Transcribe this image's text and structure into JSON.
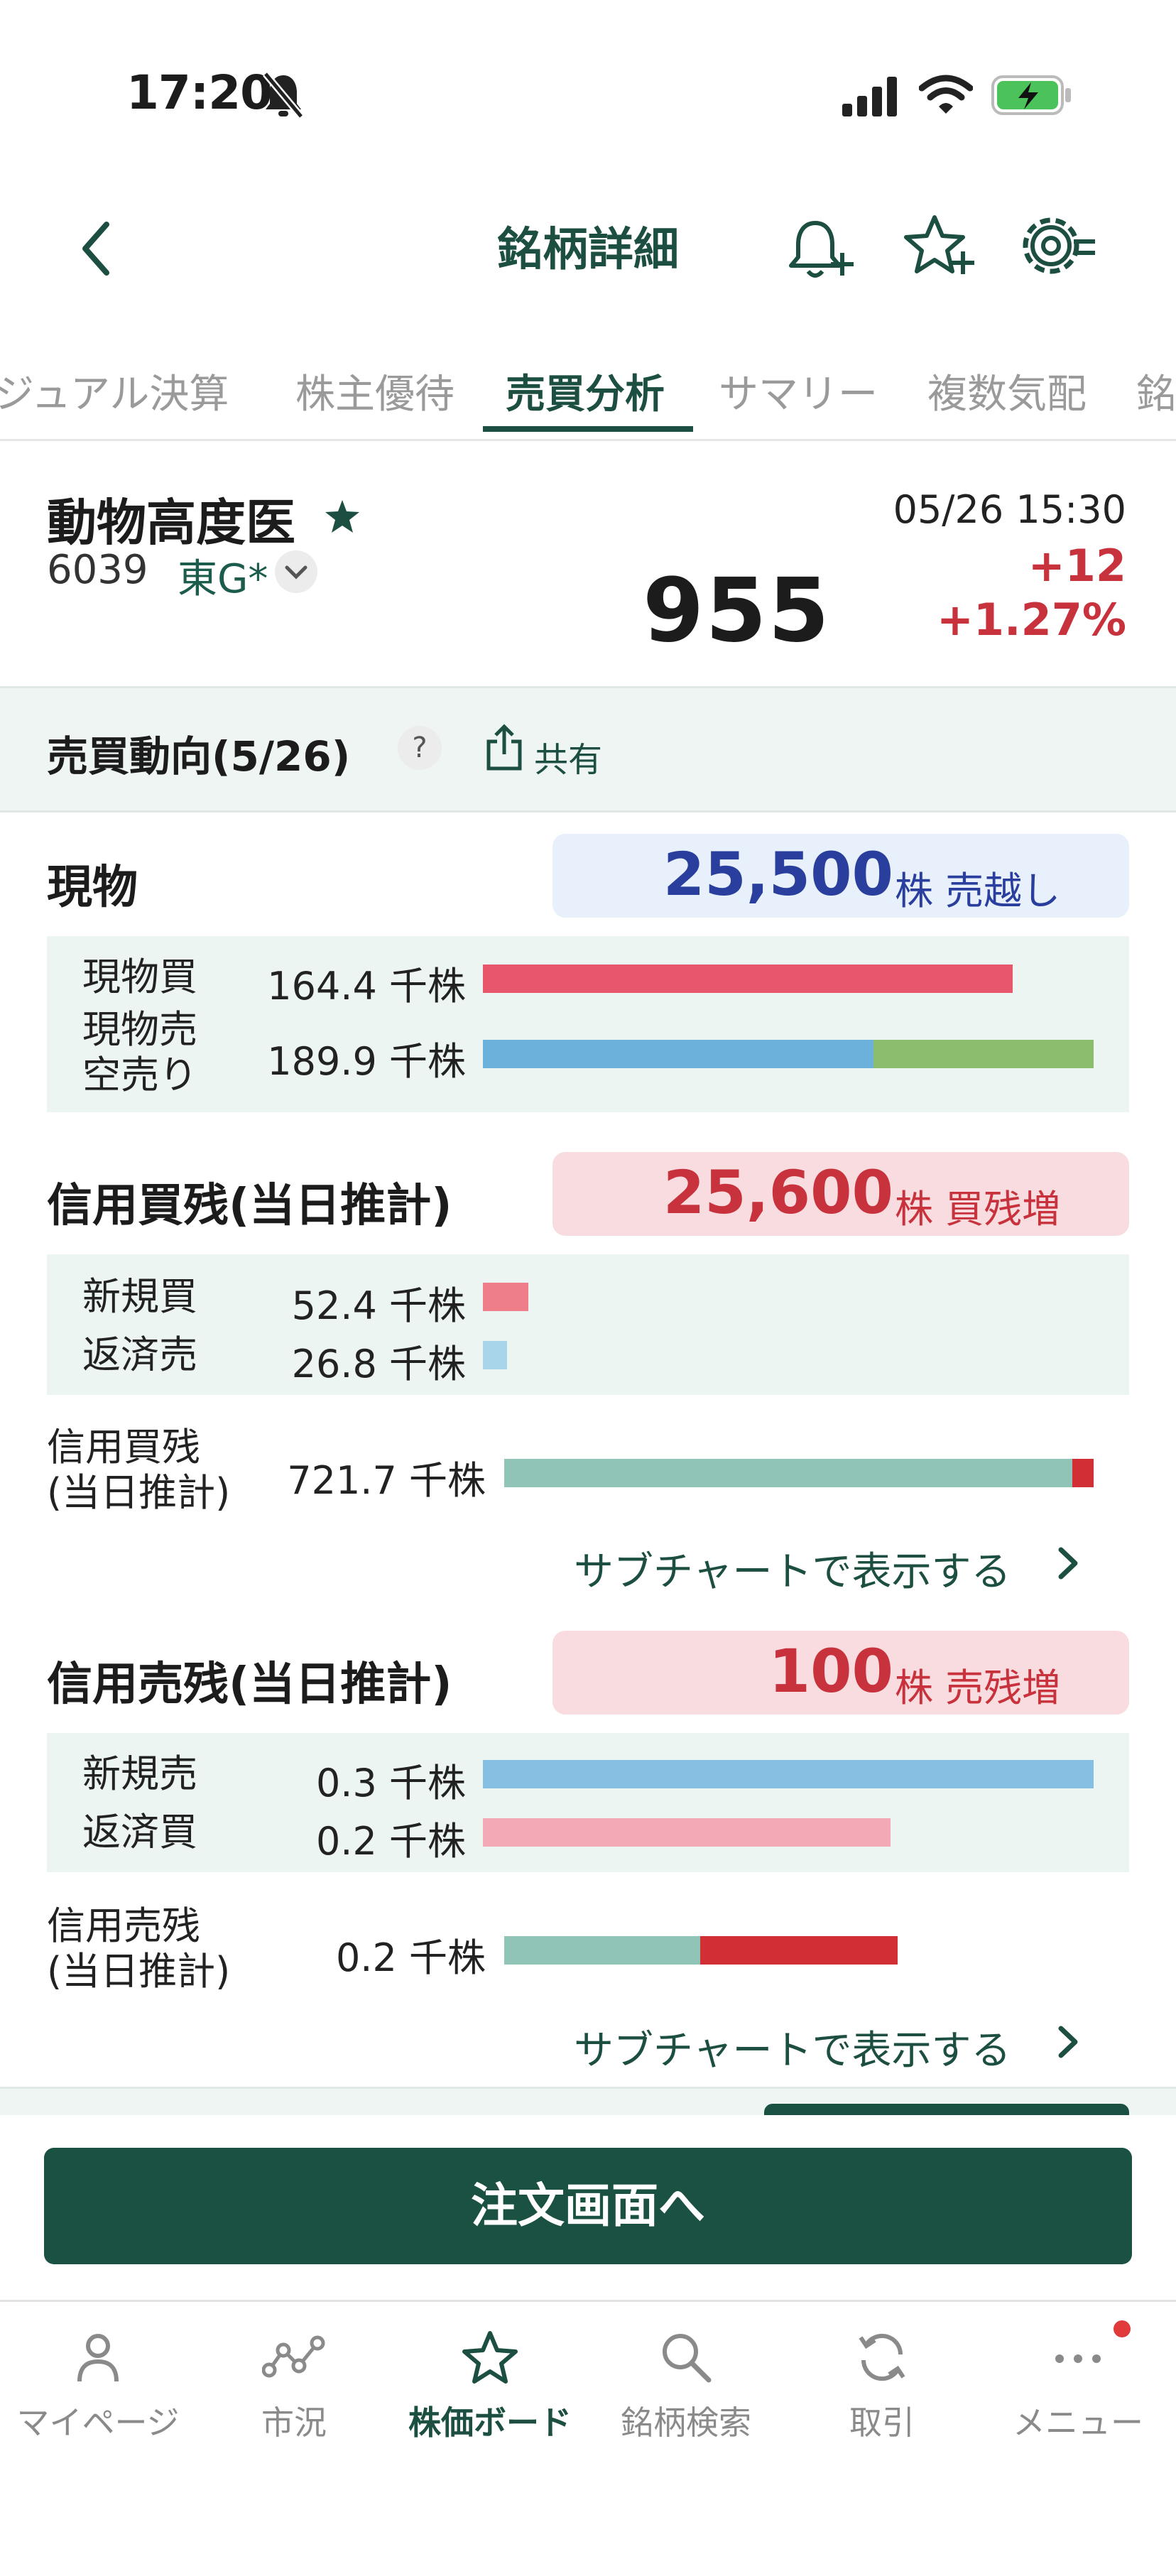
{
  "status": {
    "time": "17:20"
  },
  "header": {
    "title": "銘柄詳細"
  },
  "tabs": [
    {
      "label": "ビジュアル決算"
    },
    {
      "label": "株主優待"
    },
    {
      "label": "売買分析"
    },
    {
      "label": "サマリー"
    },
    {
      "label": "複数気配"
    },
    {
      "label": "銘柄"
    }
  ],
  "stock": {
    "name": "動物高度医",
    "code": "6039",
    "market": "東G*",
    "datetime": "05/26 15:30",
    "price": "955",
    "change": "+12",
    "change_pct": "+1.27%"
  },
  "section": {
    "title": "売買動向(5/26)",
    "help": "?",
    "share": "共有"
  },
  "genbutsu": {
    "title": "現物",
    "total": "25,500",
    "unit": "株 売越し",
    "rows": [
      {
        "label": "現物買",
        "value": "164.4 千株"
      },
      {
        "label": "現物売\n空売り",
        "value": "189.9 千株"
      }
    ]
  },
  "margin_buy": {
    "title": "信用買残(当日推計)",
    "total": "25,600",
    "unit": "株 買残増",
    "rows": [
      {
        "label": "新規買",
        "value": "52.4 千株"
      },
      {
        "label": "返済売",
        "value": "26.8 千株"
      }
    ],
    "balance_label": "信用買残\n(当日推計)",
    "balance_value": "721.7 千株",
    "link": "サブチャートで表示する"
  },
  "margin_sell": {
    "title": "信用売残(当日推計)",
    "total": "100",
    "unit": "株 売残増",
    "rows": [
      {
        "label": "新規売",
        "value": "0.3 千株"
      },
      {
        "label": "返済買",
        "value": "0.2 千株"
      }
    ],
    "balance_label": "信用売残\n(当日推計)",
    "balance_value": "0.2 千株",
    "link": "サブチャートで表示する"
  },
  "order_button": "注文画面へ",
  "nav": [
    {
      "label": "マイページ",
      "icon": "person-icon"
    },
    {
      "label": "市況",
      "icon": "market-icon"
    },
    {
      "label": "株価ボード",
      "icon": "star-icon"
    },
    {
      "label": "銘柄検索",
      "icon": "search-icon"
    },
    {
      "label": "取引",
      "icon": "refresh-icon"
    },
    {
      "label": "メニュー",
      "icon": "more-icon"
    }
  ],
  "colors": {
    "brand": "#1b5142",
    "up": "#c8323c",
    "sell_blue": "#2a3f9d",
    "buy_bar": "#e8566b",
    "sell_bar": "#6bb1db",
    "short_bar": "#8cbd6e",
    "balance_bar": "#8fc4b6"
  }
}
